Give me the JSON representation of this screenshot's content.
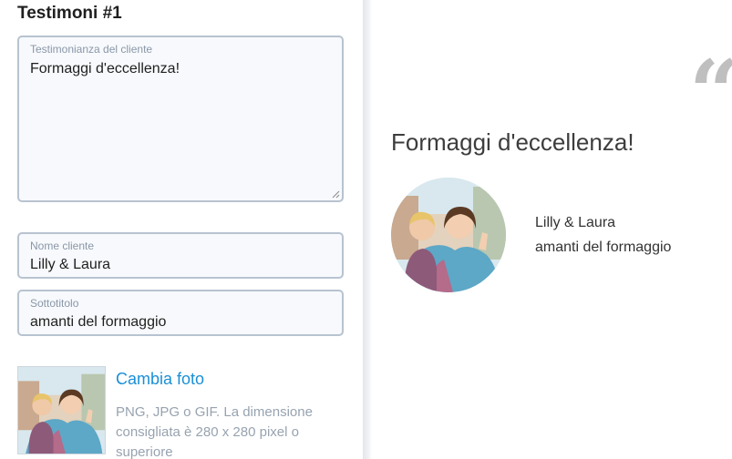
{
  "editor": {
    "title": "Testimoni #1",
    "testimonial": {
      "label": "Testimonianza del cliente",
      "value": "Formaggi d'eccellenza!"
    },
    "customer_name": {
      "label": "Nome cliente",
      "value": "Lilly & Laura"
    },
    "subtitle": {
      "label": "Sottotitolo",
      "value": "amanti del formaggio"
    },
    "photo": {
      "change_label": "Cambia foto",
      "hint": "PNG, JPG o GIF. La dimensione consigliata è 280 x 280 pixel o superiore"
    }
  },
  "preview": {
    "quote_mark": "“",
    "quote": "Formaggi d'eccellenza!",
    "name": "Lilly & Laura",
    "subtitle": "amanti del formaggio"
  }
}
